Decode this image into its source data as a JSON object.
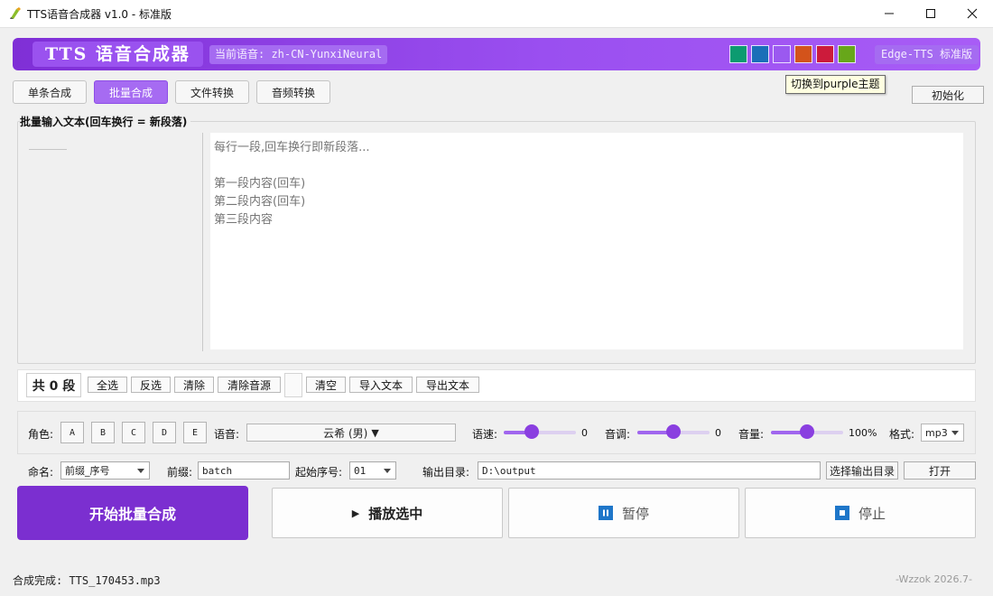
{
  "window": {
    "title": "TTS语音合成器 v1.0 - 标准版"
  },
  "header": {
    "app_name": "TTS 语音合成器",
    "current_voice": "当前语音: zh-CN-YunxiNeural",
    "edition": "Edge-TTS 标准版",
    "theme_swatches": [
      {
        "name": "teal",
        "color": "#0c9b70"
      },
      {
        "name": "blue",
        "color": "#1a6fb8"
      },
      {
        "name": "purple",
        "color": "#9b59f0"
      },
      {
        "name": "orange",
        "color": "#d3531b"
      },
      {
        "name": "red",
        "color": "#cc1b3b"
      },
      {
        "name": "green",
        "color": "#67a71a"
      }
    ],
    "tooltip": "切换到purple主题"
  },
  "tabs": [
    "单条合成",
    "批量合成",
    "文件转换",
    "音频转换"
  ],
  "active_tab": "批量合成",
  "init_button": "初始化",
  "batch": {
    "group_label": "批量输入文本(回车换行 = 新段落)",
    "placeholder": "每行一段,回车换行即新段落...\n\n第一段内容(回车)\n第二段内容(回车)\n第三段内容"
  },
  "segments": {
    "count_label": "共 0 段",
    "buttons_left": [
      "全选",
      "反选",
      "清除",
      "清除音源"
    ],
    "buttons_right": [
      "清空",
      "导入文本",
      "导出文本"
    ]
  },
  "params": {
    "role_label": "角色:",
    "roles": [
      "A",
      "B",
      "C",
      "D",
      "E"
    ],
    "voice_label": "语音:",
    "voice_value": "云希 (男)",
    "speed_label": "语速:",
    "speed_value": "0",
    "speed_level": 0.38,
    "pitch_label": "音调:",
    "pitch_value": "0",
    "pitch_level": 0.5,
    "volume_label": "音量:",
    "volume_value": "100%",
    "volume_level": 0.5,
    "format_label": "格式:",
    "format_value": "mp3"
  },
  "naming": {
    "name_label": "命名:",
    "name_mode": "前缀_序号",
    "prefix_label": "前缀:",
    "prefix_value": "batch",
    "start_label": "起始序号:",
    "start_value": "01",
    "output_label": "输出目录:",
    "output_value": "D:\\output",
    "choose_output": "选择输出目录",
    "open": "打开"
  },
  "actions": {
    "start": "开始批量合成",
    "play": "播放选中",
    "pause": "暂停",
    "stop": "停止"
  },
  "status": {
    "message": "合成完成: TTS_170453.mp3",
    "credit": "-Wzzok 2026.7-"
  }
}
